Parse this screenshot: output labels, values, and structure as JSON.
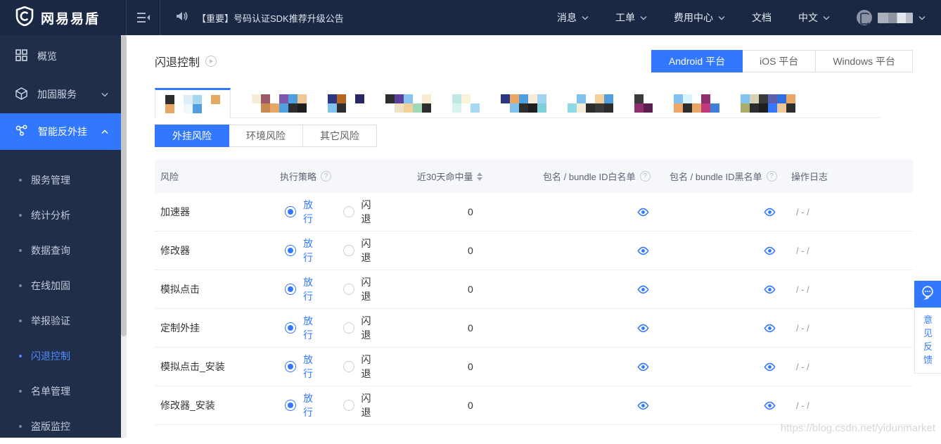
{
  "colors": {
    "accent": "#3278ff",
    "topbar": "#1b2844",
    "sidebar": "#212e4a",
    "active_text": "#4f8bff"
  },
  "topbar": {
    "logo_text": "网易易盾",
    "announcement": "【重要】号码认证SDK推荐升级公告",
    "nav": [
      {
        "label": "消息",
        "dropdown": true
      },
      {
        "label": "工单",
        "dropdown": true
      },
      {
        "label": "费用中心",
        "dropdown": true
      },
      {
        "label": "文档",
        "dropdown": false
      },
      {
        "label": "中文",
        "dropdown": true
      }
    ]
  },
  "sidebar": {
    "items": [
      {
        "label": "概览",
        "icon": "grid-icon",
        "chevron": "",
        "active": false
      },
      {
        "label": "加固服务",
        "icon": "cube-icon",
        "chevron": "down",
        "active": false
      },
      {
        "label": "智能反外挂",
        "icon": "nodes-icon",
        "chevron": "up",
        "active": true
      }
    ],
    "subitems": [
      {
        "label": "服务管理",
        "active": false
      },
      {
        "label": "统计分析",
        "active": false
      },
      {
        "label": "数据查询",
        "active": false
      },
      {
        "label": "在线加固",
        "active": false
      },
      {
        "label": "举报验证",
        "active": false
      },
      {
        "label": "闪退控制",
        "active": true
      },
      {
        "label": "名单管理",
        "active": false
      },
      {
        "label": "盗版监控",
        "active": false
      }
    ]
  },
  "main": {
    "page_title": "闪退控制",
    "platform_tabs": [
      {
        "label": "Android 平台",
        "active": true
      },
      {
        "label": "iOS 平台",
        "active": false
      },
      {
        "label": "Windows 平台",
        "active": false
      }
    ],
    "app_tabs": [
      {
        "active": true,
        "blocks": [
          [
            "#2d2d2d",
            "#e9a765"
          ],
          [
            null,
            null
          ],
          [
            "#ddeef8",
            "#f0f8fc"
          ],
          [
            "#a5d6f2",
            "#4f9fe0"
          ],
          [
            null,
            null
          ],
          [
            "#e2a963",
            null
          ]
        ]
      },
      {
        "active": false,
        "blocks": [
          [
            "#f6ecd8",
            null
          ],
          [
            "#9c5a68",
            "#c88a50"
          ],
          [
            null,
            "#e9a765"
          ],
          [
            "#7e57ad",
            "#4f9fe0"
          ],
          [
            "#4f9fe0",
            "#2d2d2d"
          ],
          [
            "#f0c896",
            "#1f1f1f"
          ]
        ]
      },
      {
        "active": false,
        "blocks": [
          [
            "#2a3780",
            "#7ec0ee"
          ],
          [
            "#b5651d",
            "#2d2d2d"
          ],
          [
            null,
            null
          ],
          [
            "#252a66",
            null
          ]
        ]
      },
      {
        "active": false,
        "blocks": [
          [
            "#2d2d2d",
            null
          ],
          [
            "#5b3f9e",
            "#efe1c4"
          ],
          [
            "#89c4f0",
            "#f3cf9a"
          ],
          [
            null,
            "#9fd8b5"
          ],
          [
            "#f7ecd2",
            "#2d2d2d"
          ]
        ]
      },
      {
        "active": false,
        "blocks": [
          [
            "#bfe8e4",
            "#d8f2ee"
          ],
          [
            "#f9f3dc",
            null
          ],
          [
            null,
            "#a8d8f5"
          ]
        ]
      },
      {
        "active": false,
        "blocks": [
          [
            "#2a3780",
            null
          ],
          [
            "#e9a765",
            "#7ec0ee"
          ],
          [
            "#4f9fe0",
            "#2d2d2d"
          ],
          [
            "#f6ecd8",
            "#1f1f1f"
          ],
          [
            "#9fd4f2",
            "#7fd0d8"
          ]
        ]
      },
      {
        "active": false,
        "blocks": [
          [
            null,
            "#8fd8e8"
          ],
          [
            "#7ec0ee",
            "#f6ecd8"
          ],
          [
            null,
            "#2d2d2d"
          ],
          [
            "#f3cf9a",
            "#3a3a3a"
          ],
          [
            "#4f9fe0",
            "#2d2d2d"
          ]
        ]
      },
      {
        "active": false,
        "blocks": [
          [
            "#3a3a3a",
            "#8e2f6e"
          ],
          [
            null,
            "#5a1f4e"
          ]
        ]
      },
      {
        "active": false,
        "blocks": [
          [
            "#7ec0ee",
            "#f0a868"
          ],
          [
            "#d8f4fc",
            "#2d2d2d"
          ],
          [
            null,
            "#e9a765"
          ],
          [
            "#8e2f6e",
            "#c03a7a"
          ],
          [
            null,
            "#3f7fd9"
          ]
        ]
      },
      {
        "active": false,
        "blocks": [
          [
            "#85c3ef",
            "#a8ad6a"
          ],
          [
            "#d6d2b8",
            "#2d2d2d"
          ],
          [
            "#3a3a3a",
            "#1f1f1f"
          ],
          [
            "#5b5fae",
            "#3478ff"
          ],
          [
            "#2d6fe0",
            "#f0c896"
          ],
          [
            "#e9a765",
            "#2d2d2d"
          ]
        ]
      }
    ],
    "risk_tabs": [
      {
        "label": "外挂风险",
        "active": true
      },
      {
        "label": "环境风险",
        "active": false
      },
      {
        "label": "其它风险",
        "active": false
      }
    ],
    "table": {
      "headers": [
        {
          "label": "风险"
        },
        {
          "label": "执行策略",
          "help": true
        },
        {
          "label": "近30天命中量",
          "sortable": true
        },
        {
          "label": "包名 / bundle ID白名单",
          "help": true
        },
        {
          "label": "包名 / bundle ID黑名单",
          "help": true
        },
        {
          "label": "操作日志"
        }
      ],
      "radio_options": [
        "放行",
        "闪退"
      ],
      "rows": [
        {
          "risk": "加速器",
          "selected": 0,
          "hits": "0",
          "log": "/ - /"
        },
        {
          "risk": "修改器",
          "selected": 0,
          "hits": "0",
          "log": "/ - /"
        },
        {
          "risk": "模拟点击",
          "selected": 0,
          "hits": "0",
          "log": "/ - /"
        },
        {
          "risk": "定制外挂",
          "selected": 0,
          "hits": "0",
          "log": "/ - /"
        },
        {
          "risk": "模拟点击_安装",
          "selected": 0,
          "hits": "0",
          "log": "/ - /"
        },
        {
          "risk": "修改器_安装",
          "selected": 0,
          "hits": "0",
          "log": "/ - /"
        }
      ]
    }
  },
  "feedback": {
    "label": "意见反馈"
  },
  "watermark": "https://blog.csdn.net/yidunmarket"
}
